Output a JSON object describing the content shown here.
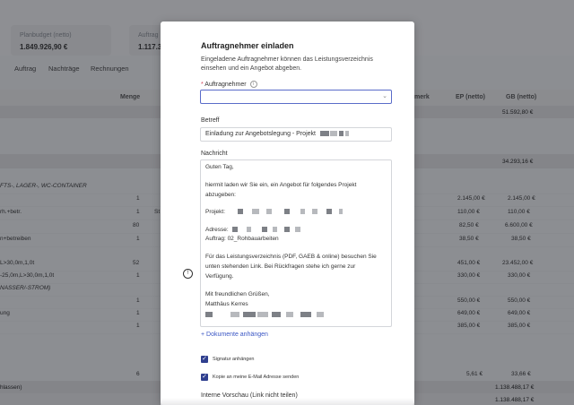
{
  "background": {
    "cards": [
      {
        "label": "Planbudget (netto)",
        "value": "1.849.926,90 €"
      },
      {
        "label": "Auftrag",
        "value": "1.117.34"
      }
    ],
    "tabs": [
      "Auftrag",
      "Nachträge",
      "Rechnungen"
    ],
    "header": {
      "menge": "Menge",
      "bemerk": "merk",
      "ep": "EP (netto)",
      "gb": "GB (netto)"
    },
    "rows": [
      {
        "desc": "",
        "qty": "",
        "unit": "",
        "ep": "",
        "gb": "51.592,80 €"
      },
      {
        "desc": "",
        "qty": "",
        "unit": "",
        "ep": "",
        "gb": "34.293,16 €"
      },
      {
        "desc": "FTS-, LAGER-, WC-CONTAINER",
        "qty": "",
        "unit": "",
        "ep": "",
        "gb": ""
      },
      {
        "desc": "",
        "qty": "1",
        "unit": "",
        "ep": "2.145,00 €",
        "gb": "2.145,00 €"
      },
      {
        "desc": "rh.+betr.",
        "qty": "1",
        "unit": "St",
        "ep": "110,00 €",
        "gb": "110,00 €"
      },
      {
        "desc": "",
        "qty": "80",
        "unit": "",
        "ep": "82,50 €",
        "gb": "6.600,00 €"
      },
      {
        "desc": "n+betreiben",
        "qty": "1",
        "unit": "",
        "ep": "38,50 €",
        "gb": "38,50 €"
      },
      {
        "desc": "L>30,0m,1,0t",
        "qty": "52",
        "unit": "",
        "ep": "451,00 €",
        "gb": "23.452,00 €"
      },
      {
        "desc": "-25,0m,L>30,0m,1,0t",
        "qty": "1",
        "unit": "",
        "ep": "330,00 €",
        "gb": "330,00 €"
      },
      {
        "desc": "NASSER/-STROM)",
        "qty": "",
        "unit": "",
        "ep": "",
        "gb": ""
      },
      {
        "desc": "",
        "qty": "1",
        "unit": "",
        "ep": "550,00 €",
        "gb": "550,00 €"
      },
      {
        "desc": "ung",
        "qty": "1",
        "unit": "",
        "ep": "649,00 €",
        "gb": "649,00 €"
      },
      {
        "desc": "",
        "qty": "1",
        "unit": "",
        "ep": "385,00 €",
        "gb": "385,00 €"
      },
      {
        "desc": "",
        "qty": "6",
        "unit": "",
        "ep": "5,61 €",
        "gb": "33,66 €"
      },
      {
        "desc": "hlassen)",
        "qty": "",
        "unit": "",
        "ep": "",
        "gb": "1.138.488,17 €"
      },
      {
        "desc": "",
        "qty": "",
        "unit": "",
        "ep": "",
        "gb": "1.138.488,17 €"
      }
    ]
  },
  "modal": {
    "title": "Auftragnehmer einladen",
    "description": "Eingeladene Auftragnehmer können das Leistungsverzeichnis einsehen und ein Angebot abgeben.",
    "contractor_label": "Auftragnehmer",
    "contractor_required": "*",
    "subject_label": "Betreff",
    "subject_value": "Einladung zur Angebotslegung - Projekt",
    "message_label": "Nachricht",
    "message_lines": {
      "l1": "Guten Tag,",
      "l2": "hiermit laden wir Sie ein, ein Angebot für folgendes Projekt",
      "l3": "abzugeben:",
      "l4": "Projekt:",
      "l5": "Adresse:",
      "l6": "Auftrag: 02_Rohbauarbeiten",
      "l7": "Für das Leistungsverzeichnis (PDF, GAEB & online) besuchen Sie",
      "l8": "unten stehenden Link. Bei Rückfragen stehe ich gerne zur",
      "l9": "Verfügung.",
      "l10": "Mit freundlichen Grüßen,",
      "l11": "Matthäus Kerres"
    },
    "attach_link": "Dokumente anhängen",
    "attach_icon": "plus-icon",
    "checkbox_signature": "Signatur anhängen",
    "checkbox_copy": "Kopie an meine E-Mail Adresse senden",
    "preview_label": "Interne Vorschau (Link nicht teilen)"
  },
  "colors": {
    "accent": "#3a56c4",
    "checkbox": "#2f3f8f",
    "required": "#d6455d"
  }
}
